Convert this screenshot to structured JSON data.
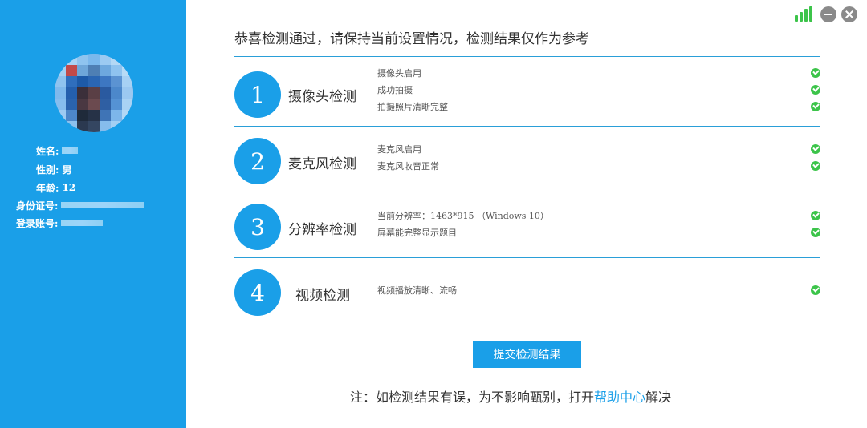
{
  "sidebar": {
    "labels": {
      "name": "姓名:",
      "gender": "性别:",
      "age": "年龄:",
      "id_number": "身份证号:",
      "account": "登录账号:"
    },
    "values": {
      "gender": "男",
      "age": "12"
    }
  },
  "header": {
    "headline": "恭喜检测通过，请保持当前设置情况，检测结果仅作为参考"
  },
  "sections": [
    {
      "number": "1",
      "title": "摄像头检测",
      "items": [
        "摄像头启用",
        "成功拍摄",
        "拍摄照片清晰完整"
      ]
    },
    {
      "number": "2",
      "title": "麦克风检测",
      "items": [
        "麦克风启用",
        "麦克风收音正常"
      ]
    },
    {
      "number": "3",
      "title": "分辨率检测",
      "items": [
        "当前分辨率：1463*915 （Windows 10）",
        "屏幕能完整显示题目"
      ]
    },
    {
      "number": "4",
      "title": "视频检测",
      "items": [
        "视频播放清晰、流畅"
      ]
    }
  ],
  "submit_label": "提交检测结果",
  "note": {
    "prefix": "注：如检测结果有误，为不影响甄别，打开",
    "link": "帮助中心",
    "suffix": "解决"
  },
  "colors": {
    "accent": "#1a9fe8",
    "check": "#3cc44a"
  },
  "icons": [
    "signal-icon",
    "minimize-icon",
    "close-icon",
    "check-icon"
  ]
}
